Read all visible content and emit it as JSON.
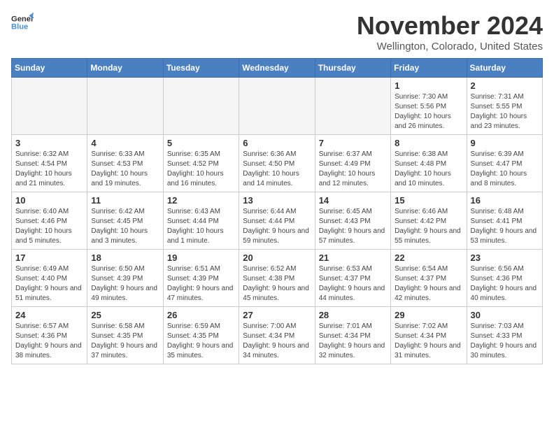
{
  "header": {
    "logo_line1": "General",
    "logo_line2": "Blue",
    "month_title": "November 2024",
    "location": "Wellington, Colorado, United States"
  },
  "weekdays": [
    "Sunday",
    "Monday",
    "Tuesday",
    "Wednesday",
    "Thursday",
    "Friday",
    "Saturday"
  ],
  "weeks": [
    [
      {
        "day": "",
        "info": ""
      },
      {
        "day": "",
        "info": ""
      },
      {
        "day": "",
        "info": ""
      },
      {
        "day": "",
        "info": ""
      },
      {
        "day": "",
        "info": ""
      },
      {
        "day": "1",
        "info": "Sunrise: 7:30 AM\nSunset: 5:56 PM\nDaylight: 10 hours\nand 26 minutes."
      },
      {
        "day": "2",
        "info": "Sunrise: 7:31 AM\nSunset: 5:55 PM\nDaylight: 10 hours\nand 23 minutes."
      }
    ],
    [
      {
        "day": "3",
        "info": "Sunrise: 6:32 AM\nSunset: 4:54 PM\nDaylight: 10 hours\nand 21 minutes."
      },
      {
        "day": "4",
        "info": "Sunrise: 6:33 AM\nSunset: 4:53 PM\nDaylight: 10 hours\nand 19 minutes."
      },
      {
        "day": "5",
        "info": "Sunrise: 6:35 AM\nSunset: 4:52 PM\nDaylight: 10 hours\nand 16 minutes."
      },
      {
        "day": "6",
        "info": "Sunrise: 6:36 AM\nSunset: 4:50 PM\nDaylight: 10 hours\nand 14 minutes."
      },
      {
        "day": "7",
        "info": "Sunrise: 6:37 AM\nSunset: 4:49 PM\nDaylight: 10 hours\nand 12 minutes."
      },
      {
        "day": "8",
        "info": "Sunrise: 6:38 AM\nSunset: 4:48 PM\nDaylight: 10 hours\nand 10 minutes."
      },
      {
        "day": "9",
        "info": "Sunrise: 6:39 AM\nSunset: 4:47 PM\nDaylight: 10 hours\nand 8 minutes."
      }
    ],
    [
      {
        "day": "10",
        "info": "Sunrise: 6:40 AM\nSunset: 4:46 PM\nDaylight: 10 hours\nand 5 minutes."
      },
      {
        "day": "11",
        "info": "Sunrise: 6:42 AM\nSunset: 4:45 PM\nDaylight: 10 hours\nand 3 minutes."
      },
      {
        "day": "12",
        "info": "Sunrise: 6:43 AM\nSunset: 4:44 PM\nDaylight: 10 hours\nand 1 minute."
      },
      {
        "day": "13",
        "info": "Sunrise: 6:44 AM\nSunset: 4:44 PM\nDaylight: 9 hours\nand 59 minutes."
      },
      {
        "day": "14",
        "info": "Sunrise: 6:45 AM\nSunset: 4:43 PM\nDaylight: 9 hours\nand 57 minutes."
      },
      {
        "day": "15",
        "info": "Sunrise: 6:46 AM\nSunset: 4:42 PM\nDaylight: 9 hours\nand 55 minutes."
      },
      {
        "day": "16",
        "info": "Sunrise: 6:48 AM\nSunset: 4:41 PM\nDaylight: 9 hours\nand 53 minutes."
      }
    ],
    [
      {
        "day": "17",
        "info": "Sunrise: 6:49 AM\nSunset: 4:40 PM\nDaylight: 9 hours\nand 51 minutes."
      },
      {
        "day": "18",
        "info": "Sunrise: 6:50 AM\nSunset: 4:39 PM\nDaylight: 9 hours\nand 49 minutes."
      },
      {
        "day": "19",
        "info": "Sunrise: 6:51 AM\nSunset: 4:39 PM\nDaylight: 9 hours\nand 47 minutes."
      },
      {
        "day": "20",
        "info": "Sunrise: 6:52 AM\nSunset: 4:38 PM\nDaylight: 9 hours\nand 45 minutes."
      },
      {
        "day": "21",
        "info": "Sunrise: 6:53 AM\nSunset: 4:37 PM\nDaylight: 9 hours\nand 44 minutes."
      },
      {
        "day": "22",
        "info": "Sunrise: 6:54 AM\nSunset: 4:37 PM\nDaylight: 9 hours\nand 42 minutes."
      },
      {
        "day": "23",
        "info": "Sunrise: 6:56 AM\nSunset: 4:36 PM\nDaylight: 9 hours\nand 40 minutes."
      }
    ],
    [
      {
        "day": "24",
        "info": "Sunrise: 6:57 AM\nSunset: 4:36 PM\nDaylight: 9 hours\nand 38 minutes."
      },
      {
        "day": "25",
        "info": "Sunrise: 6:58 AM\nSunset: 4:35 PM\nDaylight: 9 hours\nand 37 minutes."
      },
      {
        "day": "26",
        "info": "Sunrise: 6:59 AM\nSunset: 4:35 PM\nDaylight: 9 hours\nand 35 minutes."
      },
      {
        "day": "27",
        "info": "Sunrise: 7:00 AM\nSunset: 4:34 PM\nDaylight: 9 hours\nand 34 minutes."
      },
      {
        "day": "28",
        "info": "Sunrise: 7:01 AM\nSunset: 4:34 PM\nDaylight: 9 hours\nand 32 minutes."
      },
      {
        "day": "29",
        "info": "Sunrise: 7:02 AM\nSunset: 4:34 PM\nDaylight: 9 hours\nand 31 minutes."
      },
      {
        "day": "30",
        "info": "Sunrise: 7:03 AM\nSunset: 4:33 PM\nDaylight: 9 hours\nand 30 minutes."
      }
    ]
  ]
}
